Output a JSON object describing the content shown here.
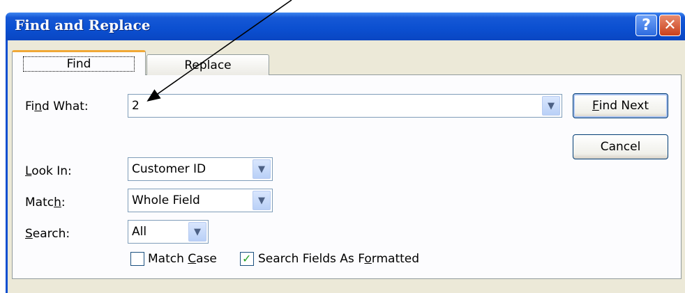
{
  "window": {
    "title": "Find and Replace",
    "help_glyph": "?",
    "close_glyph": "✕"
  },
  "tabs": [
    {
      "label": "Find"
    },
    {
      "label": "Replace"
    }
  ],
  "find_what": {
    "label_pre": "Fi",
    "label_ul": "n",
    "label_post": "d What:",
    "value": "2"
  },
  "look_in": {
    "label_ul": "L",
    "label_post": "ook In:",
    "value": "Customer ID"
  },
  "match": {
    "label_pre": "Matc",
    "label_ul": "h",
    "label_post": ":",
    "value": "Whole Field"
  },
  "search": {
    "label_ul": "S",
    "label_post": "earch:",
    "value": "All"
  },
  "buttons": {
    "find_next": {
      "ul": "F",
      "rest": "ind Next"
    },
    "cancel": "Cancel"
  },
  "checkboxes": {
    "match_case": {
      "pre": "Match ",
      "ul": "C",
      "post": "ase",
      "checked": false
    },
    "search_formatted": {
      "pre": "Search Fields As F",
      "ul": "o",
      "post": "rmatted",
      "checked": true
    }
  },
  "colors": {
    "title_bar": "#0b4fd0",
    "dialog_bg": "#ece9d8",
    "tab_highlight": "#f0a836"
  }
}
